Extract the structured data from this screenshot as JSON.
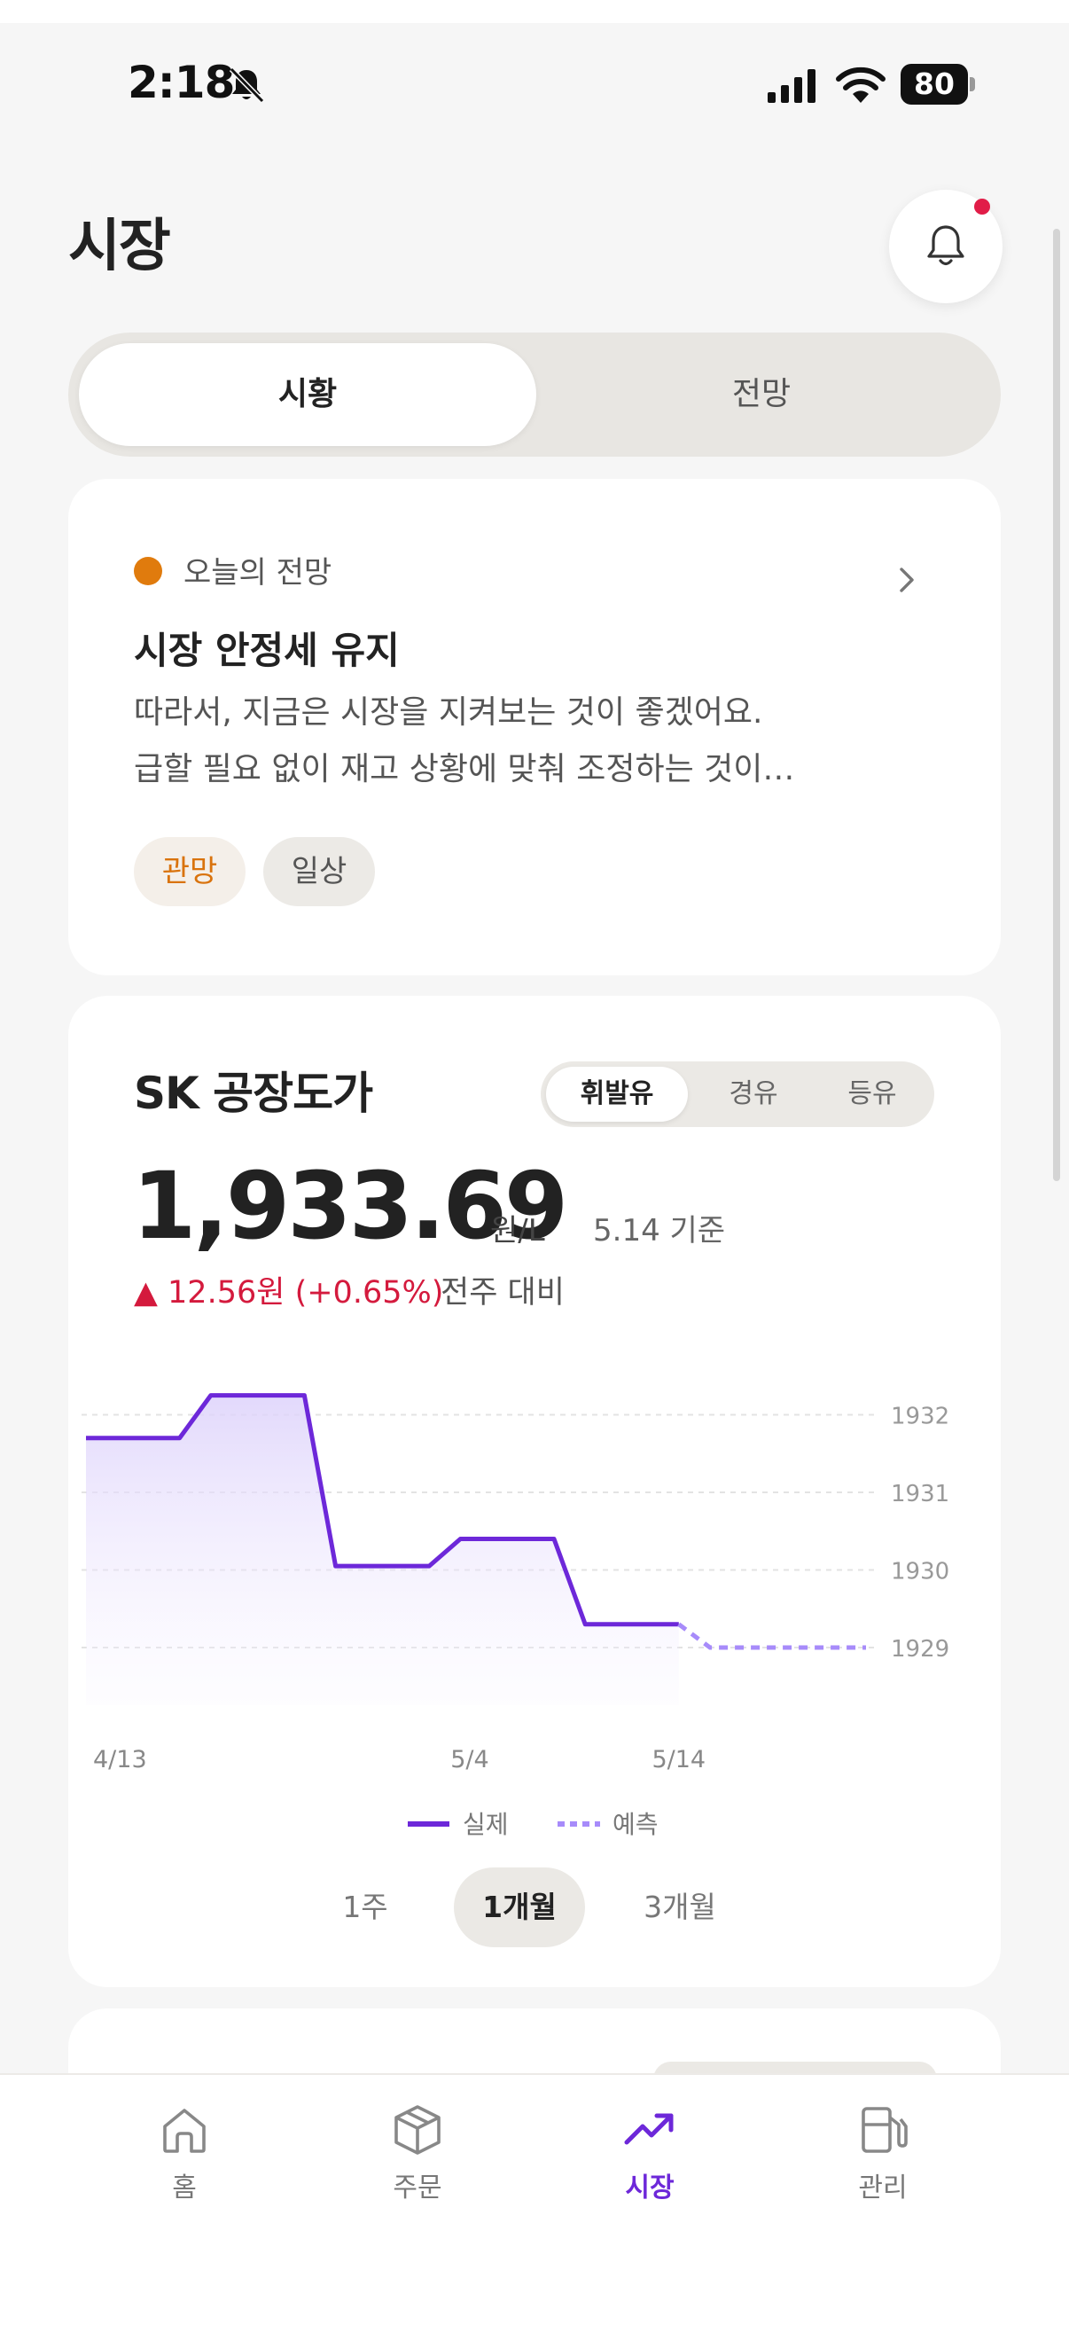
{
  "status_bar": {
    "time": "2:18",
    "battery": "80"
  },
  "header": {
    "title": "시장"
  },
  "top_tabs": [
    {
      "label": "시황",
      "active": true
    },
    {
      "label": "전망",
      "active": false
    }
  ],
  "forecast_card": {
    "label": "오늘의 전망",
    "title": "시장 안정세 유지",
    "description_lines": [
      "따라서, 지금은 시장을 지켜보는 것이 좋겠어요.",
      "급할 필요 없이 재고 상황에 맞춰 조정하는 것이…"
    ],
    "chips": [
      "관망",
      "일상"
    ],
    "dot_color": "#e07b0d"
  },
  "price_card": {
    "title": "SK 공장도가",
    "fuel_tabs": [
      {
        "label": "휘발유",
        "active": true
      },
      {
        "label": "경유",
        "active": false
      },
      {
        "label": "등유",
        "active": false
      }
    ],
    "price": "1,933.69",
    "unit": "원/L",
    "as_of": "5.14 기준",
    "change": "▲ 12.56원 (+0.65%)",
    "change_compare": "전주 대비",
    "period_tabs": [
      {
        "label": "1주",
        "active": false
      },
      {
        "label": "1개월",
        "active": true
      },
      {
        "label": "3개월",
        "active": false
      }
    ],
    "legend": {
      "actual": "실제",
      "forecast": "예측"
    }
  },
  "chart_data": {
    "type": "line",
    "x_tick_labels": [
      "4/13",
      "5/4",
      "5/14"
    ],
    "y_ticks": [
      1932,
      1931,
      1930,
      1929
    ],
    "ylim": [
      1928.6,
      1932.6
    ],
    "grid": true,
    "legend_position": "bottom",
    "series": [
      {
        "name": "실제",
        "color": "#6d28d9",
        "style": "solid",
        "area_fill": true,
        "x": [
          0,
          3,
          4,
          7,
          8,
          11,
          12,
          15,
          16,
          19
        ],
        "values": [
          1931.7,
          1931.7,
          1932.25,
          1932.25,
          1930.05,
          1930.05,
          1930.4,
          1930.4,
          1929.3,
          1929.3
        ]
      },
      {
        "name": "예측",
        "color": "#a78bfa",
        "style": "dashed",
        "x": [
          19,
          20,
          25
        ],
        "values": [
          1929.3,
          1929.0,
          1929.0
        ]
      }
    ]
  },
  "bottom_nav": [
    {
      "label": "홈",
      "icon": "home-icon",
      "active": false
    },
    {
      "label": "주문",
      "icon": "box-icon",
      "active": false
    },
    {
      "label": "시장",
      "icon": "trending-up-icon",
      "active": true
    },
    {
      "label": "관리",
      "icon": "fuel-pump-icon",
      "active": false
    }
  ],
  "colors": {
    "accent": "#6d28d9",
    "alert": "#e11d48",
    "rise": "#d41a3d",
    "orange": "#d9730d"
  }
}
